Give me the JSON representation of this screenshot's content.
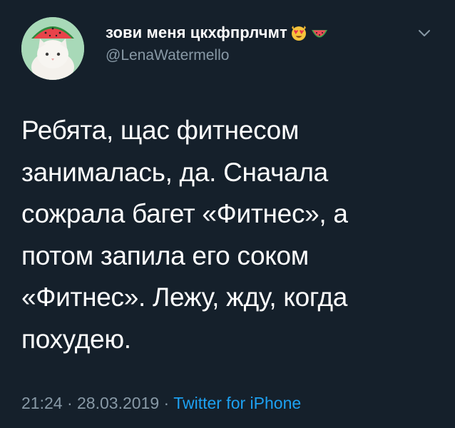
{
  "user": {
    "display_name": "зови меня цкхфпрлчмт",
    "handle": "@LenaWatermello",
    "emojis": [
      "heart-eyes-cat-icon",
      "watermelon-icon"
    ]
  },
  "tweet": {
    "text": "Ребята, щас фитнесом\nзанималась, да. Сначала\nсожрала багет «Фитнес», а\nпотом запила его соком\n«Фитнес». Лежу, жду, когда\nпохудею."
  },
  "meta": {
    "time": "21:24",
    "separator": "·",
    "date": "28.03.2019",
    "source": "Twitter for iPhone"
  },
  "colors": {
    "background": "#15202b",
    "text": "#ffffff",
    "secondary": "#8899a6",
    "link": "#1da1f2"
  }
}
